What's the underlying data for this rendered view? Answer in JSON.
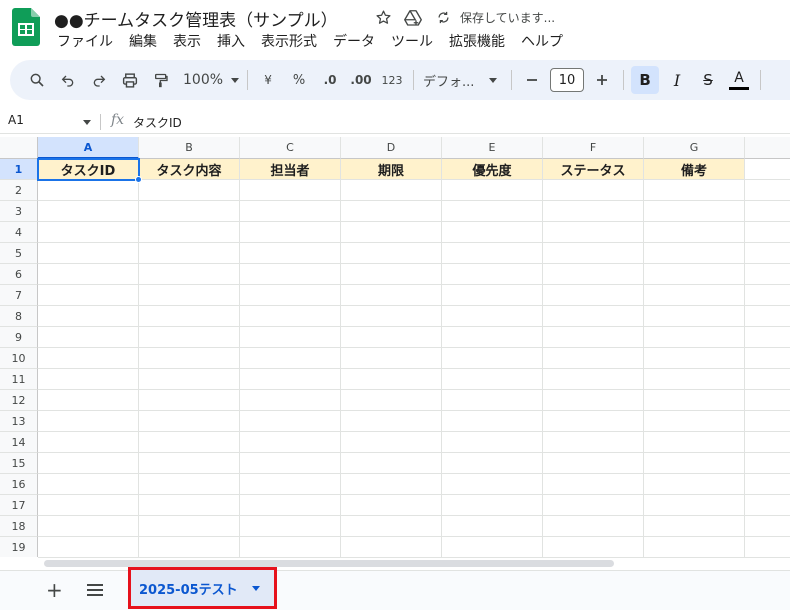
{
  "document": {
    "title": "●●チームタスク管理表（サンプル）",
    "save_status": "保存しています..."
  },
  "menu": [
    "ファイル",
    "編集",
    "表示",
    "挿入",
    "表示形式",
    "データ",
    "ツール",
    "拡張機能",
    "ヘルプ"
  ],
  "toolbar": {
    "zoom": "100%",
    "currency": "¥",
    "percent": "%",
    "decrease_decimal": ".0",
    "increase_decimal": ".00",
    "number_format": "123",
    "font_family": "デフォ...",
    "font_size": "10",
    "bold": "B",
    "italic": "I",
    "strikethrough": "S",
    "text_color": "A"
  },
  "formula_bar": {
    "name_box": "A1",
    "fx": "fx",
    "value": "タスクID"
  },
  "grid": {
    "columns": [
      "A",
      "B",
      "C",
      "D",
      "E",
      "F",
      "G"
    ],
    "rows": [
      "1",
      "2",
      "3",
      "4",
      "5",
      "6",
      "7",
      "8",
      "9",
      "10",
      "11",
      "12",
      "13",
      "14",
      "15",
      "16",
      "17",
      "18",
      "19"
    ],
    "header_row": [
      "タスクID",
      "タスク内容",
      "担当者",
      "期限",
      "優先度",
      "ステータス",
      "備考"
    ],
    "header_fill": "#fff2cc",
    "selected_cell": "A1"
  },
  "sheet_tabs": {
    "add": "+",
    "active_tab": "2025-05テスト"
  },
  "colors": {
    "accent": "#0b57d0",
    "highlight_box": "#e6111c",
    "app_icon": "#0f9d58"
  },
  "icons": [
    "spreadsheet-icon",
    "star-icon",
    "drive-move-icon",
    "sync-icon",
    "search-icon",
    "undo-icon",
    "redo-icon",
    "print-icon",
    "paint-format-icon",
    "chevron-down-icon",
    "menu-icon"
  ]
}
